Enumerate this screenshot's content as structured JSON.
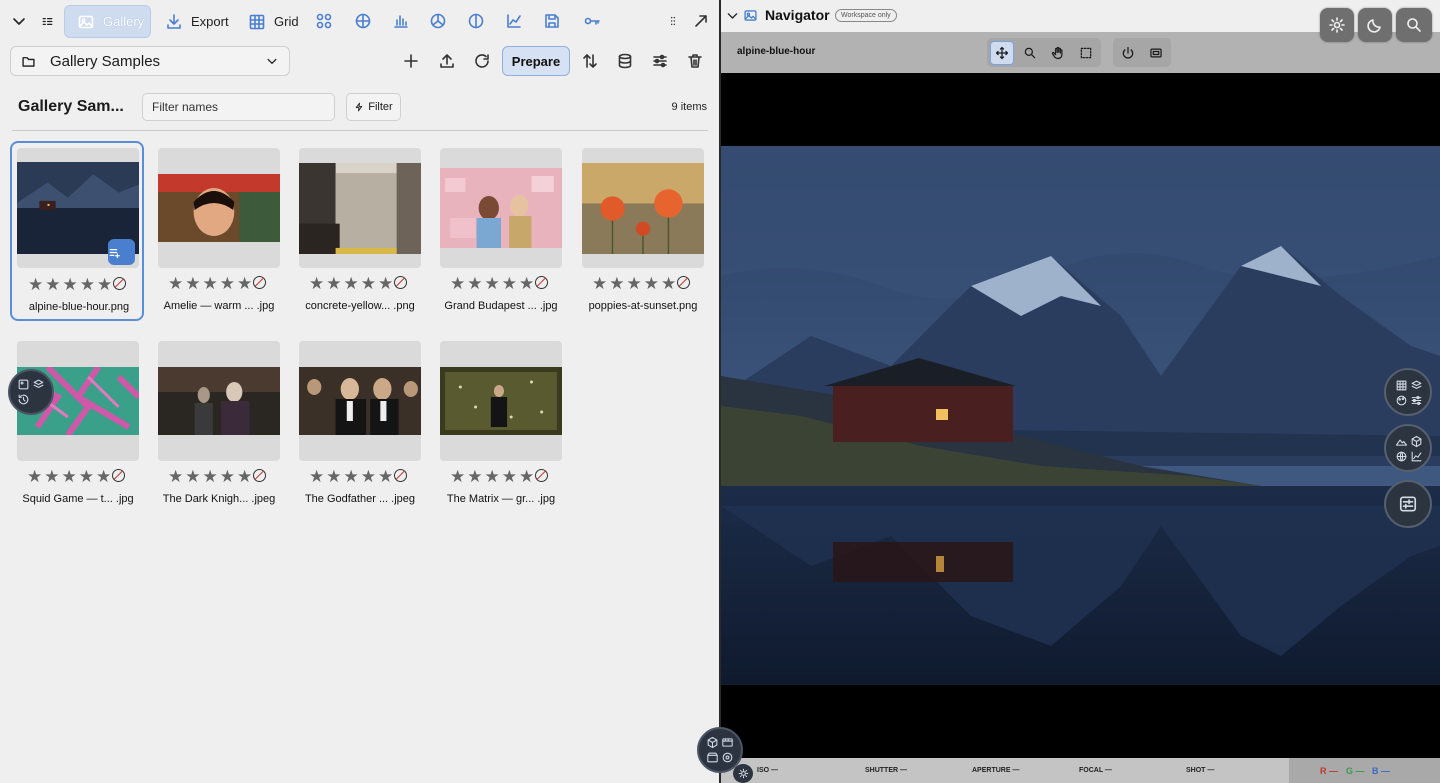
{
  "toolbar": {
    "tabs": [
      {
        "label": "Gallery",
        "icon": "image-icon"
      },
      {
        "label": "Export",
        "icon": "download-icon"
      },
      {
        "label": "Grid",
        "icon": "grid-icon"
      }
    ]
  },
  "collection": {
    "selected": "Gallery Samples"
  },
  "actions": {
    "prepare_label": "Prepare"
  },
  "gallery": {
    "title": "Gallery Sam...",
    "filter_placeholder": "Filter names",
    "filter_label": "Filter",
    "item_count": "9 items",
    "items": [
      {
        "name": "alpine-blue-hour.png",
        "rating": 0,
        "selected": true
      },
      {
        "name": "Amelie — warm ... .jpg",
        "rating": 0
      },
      {
        "name": "concrete-yellow... .png",
        "rating": 0
      },
      {
        "name": "Grand Budapest ... .jpg",
        "rating": 0
      },
      {
        "name": "poppies-at-sunset.png",
        "rating": 0
      },
      {
        "name": "Squid Game — t... .jpg",
        "rating": 0
      },
      {
        "name": "The Dark Knigh... .jpeg",
        "rating": 0
      },
      {
        "name": "The Godfather ... .jpeg",
        "rating": 0
      },
      {
        "name": "The Matrix — gr... .jpg",
        "rating": 0
      }
    ]
  },
  "navigator": {
    "title": "Navigator",
    "badge": "Workspace only",
    "file": "alpine-blue-hour"
  },
  "exif": {
    "iso_label": "ISO —",
    "shutter_label": "SHUTTER —",
    "aperture_label": "APERTURE —",
    "focal_label": "FOCAL —",
    "shot_label": "SHOT —",
    "r_label": "R —",
    "g_label": "G —",
    "b_label": "B —"
  },
  "colors": {
    "accent": "#4a7fd0",
    "panel": "#efefef",
    "fab": "#2c3440"
  }
}
